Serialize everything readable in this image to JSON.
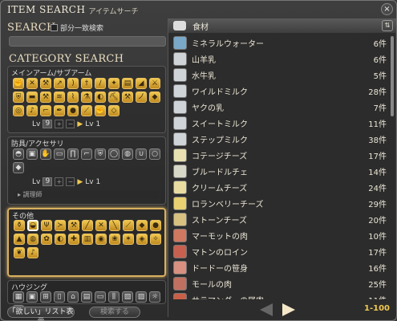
{
  "window": {
    "title": "ITEM SEARCH",
    "subtitle": "アイテムサーチ",
    "close": "×"
  },
  "search": {
    "title": "SEARCH",
    "partial_label": "部分一致検索",
    "value": ""
  },
  "category": {
    "title": "CATEGORY SEARCH"
  },
  "groups": [
    {
      "label": "メインアーム/サブアーム",
      "level": "9",
      "max_label": "Lv 1",
      "lv_label": "Lv"
    },
    {
      "label": "防具/アクセサリ",
      "level": "9",
      "max_label": "Lv 1",
      "lv_label": "Lv",
      "sub": "▸ 調理師"
    },
    {
      "label": "その他"
    },
    {
      "label": "ハウジング"
    }
  ],
  "buttons": {
    "wishlist": "「欲しい」リスト表示",
    "search": "検索する"
  },
  "results": {
    "header": "食材",
    "sort_icon": "sort-icon",
    "pages": "1-100",
    "items": [
      {
        "name": "ミネラルウォーター",
        "count": "6件",
        "color": "#7aa8c8"
      },
      {
        "name": "山羊乳",
        "count": "6件",
        "color": "#cfd4d8"
      },
      {
        "name": "水牛乳",
        "count": "5件",
        "color": "#cfd4d8"
      },
      {
        "name": "ワイルドミルク",
        "count": "28件",
        "color": "#cfd4d8"
      },
      {
        "name": "ヤクの乳",
        "count": "7件",
        "color": "#cfd4d8"
      },
      {
        "name": "スイートミルク",
        "count": "11件",
        "color": "#cfd4d8"
      },
      {
        "name": "ステップミルク",
        "count": "38件",
        "color": "#cfd4d8"
      },
      {
        "name": "コテージチーズ",
        "count": "17件",
        "color": "#e8e0b0"
      },
      {
        "name": "ブルードルチェ",
        "count": "14件",
        "color": "#d8d8c8"
      },
      {
        "name": "クリームチーズ",
        "count": "24件",
        "color": "#e8dca0"
      },
      {
        "name": "ロランベリーチーズ",
        "count": "29件",
        "color": "#e8d070"
      },
      {
        "name": "ストーンチーズ",
        "count": "20件",
        "color": "#d8c080"
      },
      {
        "name": "マーモットの肉",
        "count": "10件",
        "color": "#d07860"
      },
      {
        "name": "マトンのロイン",
        "count": "17件",
        "color": "#c86050"
      },
      {
        "name": "ドードーの笹身",
        "count": "16件",
        "color": "#d89080"
      },
      {
        "name": "モールの肉",
        "count": "25件",
        "color": "#c07060"
      },
      {
        "name": "サラマンダーの尾肉",
        "count": "11件",
        "color": "#c86048"
      }
    ]
  }
}
